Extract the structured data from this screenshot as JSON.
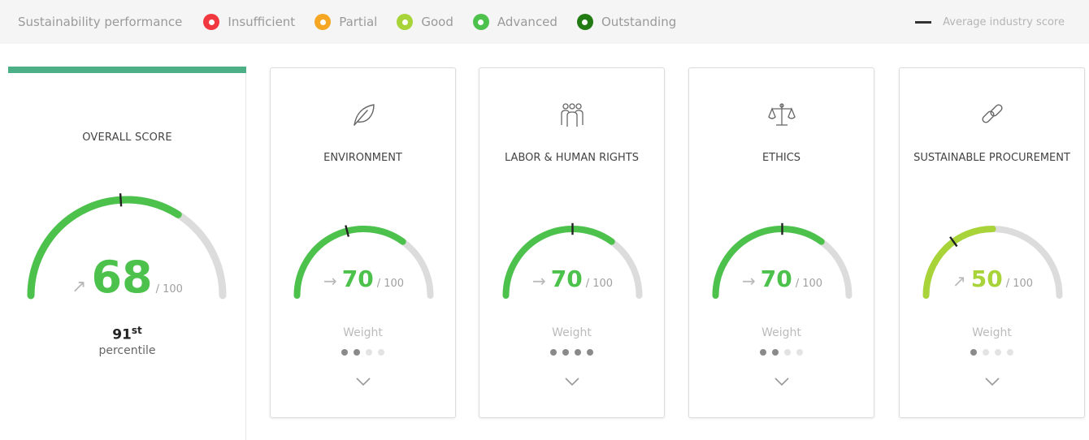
{
  "legend": {
    "title": "Sustainability performance",
    "items": [
      {
        "label": "Insufficient",
        "color": "#f2383f"
      },
      {
        "label": "Partial",
        "color": "#f5a623"
      },
      {
        "label": "Good",
        "color": "#a8d43a"
      },
      {
        "label": "Advanced",
        "color": "#4cc24c"
      },
      {
        "label": "Outstanding",
        "color": "#217a12"
      }
    ],
    "average_label": "Average industry score"
  },
  "overall": {
    "label": "OVERALL SCORE",
    "score": "68",
    "denominator": "/ 100",
    "trend_arrow": "↗",
    "score_fraction": 0.68,
    "avg_fraction": 0.48,
    "color": "#4cc24c",
    "percentile_number": "91",
    "percentile_suffix": "st",
    "percentile_text": "percentile"
  },
  "categories": [
    {
      "label": "ENVIRONMENT",
      "icon": "leaf-icon",
      "score": "70",
      "denominator": "/ 100",
      "trend_arrow": "→",
      "score_fraction": 0.7,
      "avg_fraction": 0.42,
      "color": "#4cc24c",
      "weight_label": "Weight",
      "weight_dots": [
        1,
        1,
        0,
        0
      ]
    },
    {
      "label": "LABOR & HUMAN RIGHTS",
      "icon": "people-icon",
      "score": "70",
      "denominator": "/ 100",
      "trend_arrow": "→",
      "score_fraction": 0.7,
      "avg_fraction": 0.5,
      "color": "#4cc24c",
      "weight_label": "Weight",
      "weight_dots": [
        1,
        1,
        1,
        1
      ]
    },
    {
      "label": "ETHICS",
      "icon": "scales-icon",
      "score": "70",
      "denominator": "/ 100",
      "trend_arrow": "→",
      "score_fraction": 0.7,
      "avg_fraction": 0.5,
      "color": "#4cc24c",
      "weight_label": "Weight",
      "weight_dots": [
        1,
        1,
        0,
        0
      ]
    },
    {
      "label": "SUSTAINABLE PROCUREMENT",
      "icon": "chain-link-icon",
      "score": "50",
      "denominator": "/ 100",
      "trend_arrow": "↗",
      "score_fraction": 0.5,
      "avg_fraction": 0.3,
      "color": "#a8d43a",
      "weight_label": "Weight",
      "weight_dots": [
        1,
        0,
        0,
        0
      ]
    }
  ],
  "track_color": "#dcdcdc",
  "avg_marker_color": "#222222"
}
